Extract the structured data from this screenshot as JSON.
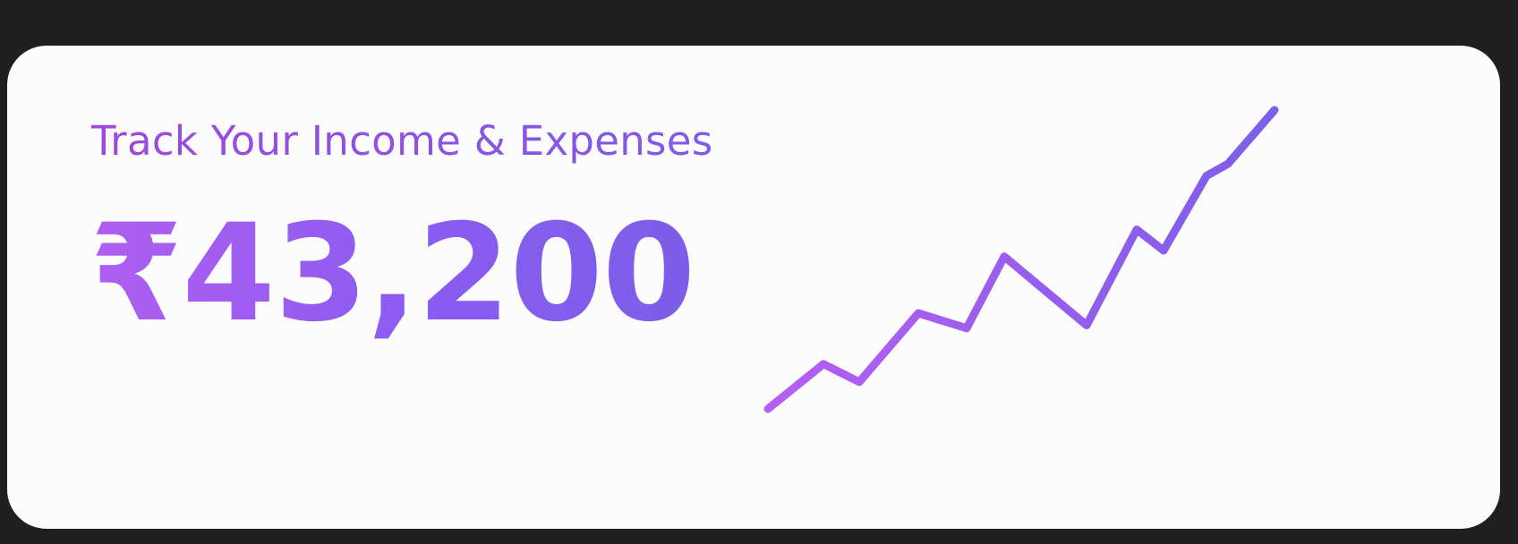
{
  "card": {
    "title": "Track Your Income & Expenses",
    "amount": "₹43,200"
  },
  "chart_data": {
    "type": "line",
    "x": [
      0,
      1,
      2,
      3,
      4,
      5,
      6,
      7,
      8,
      9,
      10,
      11,
      12
    ],
    "values": [
      0,
      15,
      9,
      32,
      27,
      51,
      28,
      60,
      53,
      78,
      82,
      100
    ],
    "title": "",
    "xlabel": "",
    "ylabel": "",
    "grid": false,
    "legend": "none"
  },
  "colors": {
    "background": "#1f1f1f",
    "card": "#fcfcfd",
    "gradient_start": "#b65ff2",
    "gradient_end": "#7c5ee8"
  }
}
